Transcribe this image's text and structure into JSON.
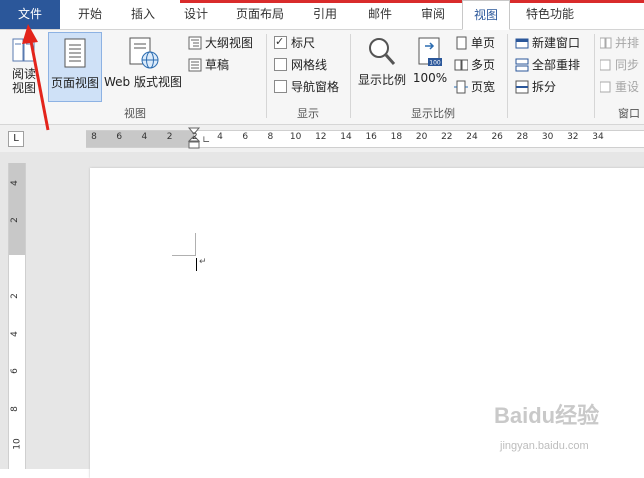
{
  "tabs": [
    "文件",
    "开始",
    "插入",
    "设计",
    "页面布局",
    "引用",
    "邮件",
    "审阅",
    "视图",
    "特色功能"
  ],
  "ribbon": {
    "views": {
      "read_mode": "阅读\n视图",
      "print_layout": "页面视图",
      "web_layout": "Web 版式视图",
      "outline": "大纲视图",
      "draft": "草稿",
      "group_label": "视图"
    },
    "show": {
      "ruler": "标尺",
      "gridlines": "网格线",
      "nav_pane": "导航窗格",
      "group_label": "显示",
      "ruler_checked": true,
      "gridlines_checked": false,
      "nav_pane_checked": false
    },
    "zoom": {
      "zoom": "显示比例",
      "hundred": "100%",
      "one_page": "单页",
      "multi_page": "多页",
      "page_width": "页宽",
      "group_label": "显示比例",
      "badge": "100"
    },
    "window": {
      "new_window": "新建窗口",
      "arrange_all": "全部重排",
      "split": "拆分",
      "side_by_side": "并排",
      "sync_scroll": "同步",
      "reset_position": "重设",
      "group_label": "窗口"
    }
  },
  "ruler": {
    "tab_selector": "L",
    "h_labels": [
      "8",
      "6",
      "4",
      "2",
      "2",
      "4",
      "6",
      "8",
      "10",
      "12",
      "14",
      "16",
      "18",
      "20",
      "22",
      "24",
      "26",
      "28",
      "30",
      "32",
      "34"
    ],
    "v_labels": [
      "4",
      "2",
      "2",
      "4",
      "6",
      "8",
      "10"
    ]
  },
  "watermark": {
    "brand": "Baidu经验",
    "url": "jingyan.baidu.com"
  },
  "colors": {
    "file_tab": "#2b579a",
    "accent": "#2b579a",
    "red_bar": "#d92b2b",
    "arrow": "#e3241b"
  }
}
